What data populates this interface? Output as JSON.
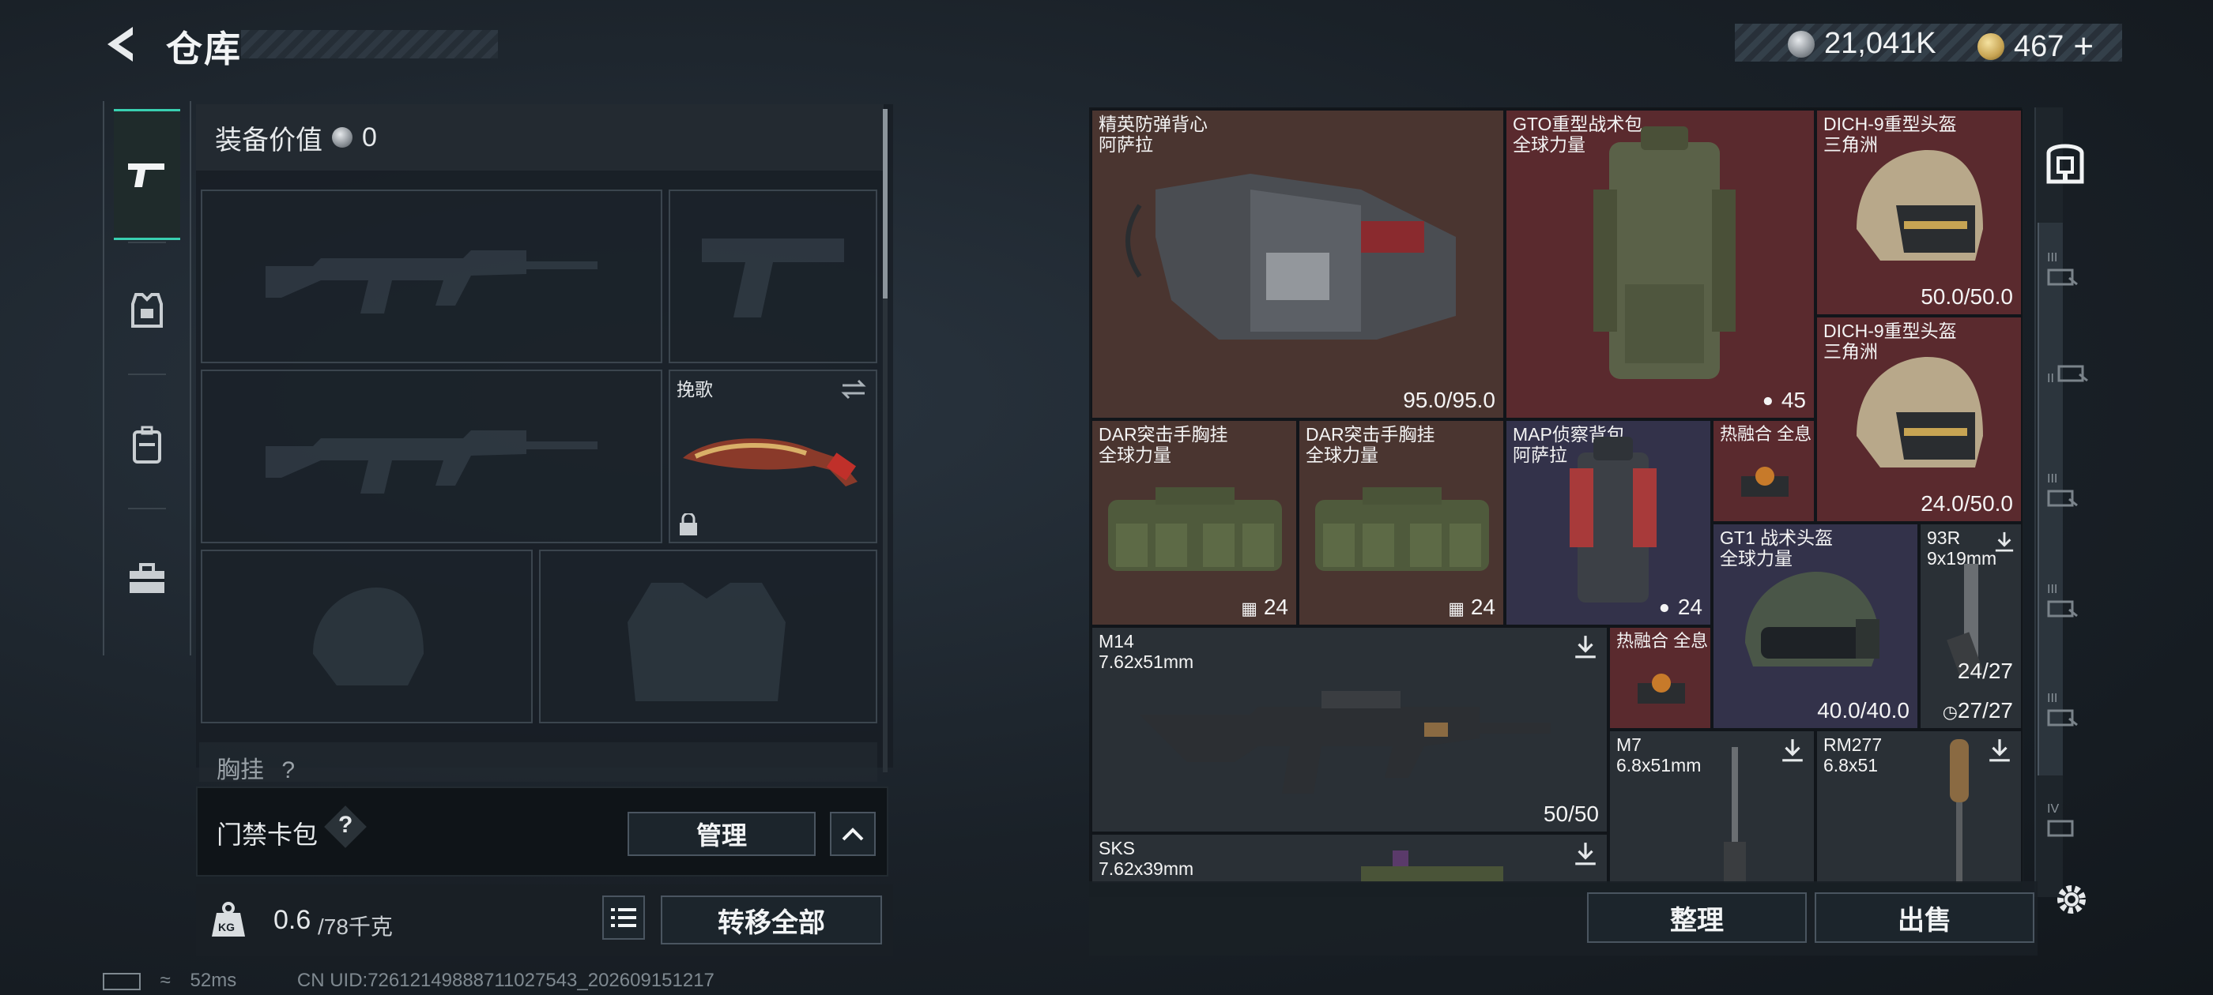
{
  "header": {
    "title": "仓库"
  },
  "currency": {
    "silver": "21,041K",
    "gold": "467",
    "gold_plus": "+"
  },
  "equipment": {
    "value_label": "装备价值",
    "value": "0",
    "melee_name": "挽歌",
    "section_peek": "胸挂",
    "section_peek_q": "?"
  },
  "card_pack": {
    "label": "门禁卡包",
    "help": "?",
    "manage_label": "管理"
  },
  "weight": {
    "current": "0.6",
    "max": "/78千克",
    "kg_icon": "KG",
    "transfer_all": "转移全部"
  },
  "inventory": {
    "items": [
      {
        "name": "精英防弹背心",
        "sub": "阿萨拉",
        "value": "95.0/95.0"
      },
      {
        "name": "GTO重型战术包",
        "sub": "全球力量",
        "value": "45"
      },
      {
        "name": "DICH-9重型头盔",
        "sub": "三角洲",
        "value": "50.0/50.0"
      },
      {
        "name": "DICH-9重型头盔",
        "sub": "三角洲",
        "value": "24.0/50.0"
      },
      {
        "name": "DAR突击手胸挂",
        "sub": "全球力量",
        "value": "24"
      },
      {
        "name": "DAR突击手胸挂",
        "sub": "全球力量",
        "value": "24"
      },
      {
        "name": "MAP侦察背包",
        "sub": "阿萨拉",
        "value": "24"
      },
      {
        "name": "热融合 全息",
        "sub": "",
        "value": ""
      },
      {
        "name": "GT1 战术头盔",
        "sub": "全球力量",
        "value": "40.0/40.0"
      },
      {
        "name": "93R",
        "sub": "9x19mm",
        "value": "24/27"
      },
      {
        "name": "M14",
        "sub": "7.62x51mm",
        "value": "50/50"
      },
      {
        "name": "热融合 全息",
        "sub": "",
        "value": ""
      },
      {
        "name": "M7",
        "sub": "6.8x51mm",
        "value": ""
      },
      {
        "name": "RM277",
        "sub": "6.8x51",
        "value": ""
      },
      {
        "name": "SKS",
        "sub": "7.62x39mm",
        "value": ""
      }
    ],
    "timer_value": "27/27",
    "sort_label": "整理",
    "sell_label": "出售"
  },
  "tiers": [
    "III",
    "II",
    "III",
    "III",
    "III",
    "IV"
  ],
  "status": {
    "ping": "52ms",
    "uid": "CN UID:72612149888711027543_202609151217"
  },
  "colors": {
    "accent": "#39d0b0",
    "red_rarity": "#5a2a2e",
    "purple_rarity": "#33324a",
    "brown_rarity": "#4a3530"
  }
}
